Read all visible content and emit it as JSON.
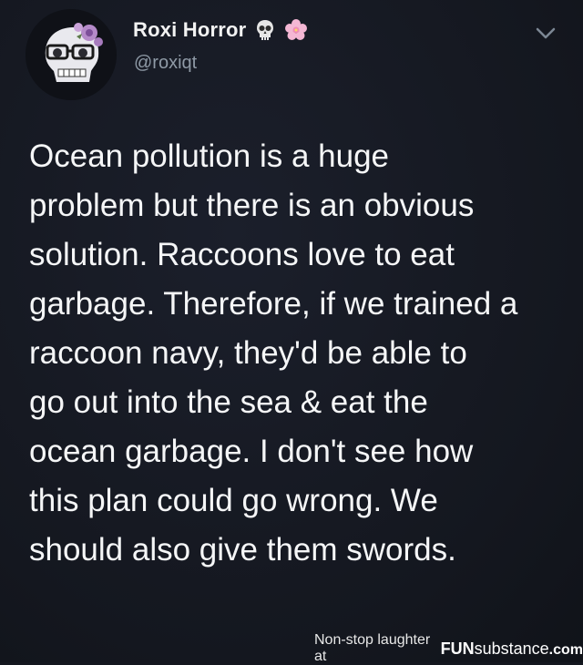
{
  "tweet": {
    "display_name": "Roxi Horror",
    "name_emojis": [
      "skull-icon",
      "cherry-blossom-icon"
    ],
    "handle": "@roxiqt",
    "text": "Ocean pollution is a huge\nproblem but there is an obvious\nsolution. Raccoons love to eat\ngarbage. Therefore, if we trained a\nraccoon navy, they'd be able to\ngo out into the sea & eat the\nocean garbage. I don't see how\nthis plan could go wrong. We\nshould also give them swords."
  },
  "footer": {
    "tagline": "Non-stop laughter at",
    "brand_main": "FUN",
    "brand_sub": "substance",
    "brand_domain": ".com"
  },
  "colors": {
    "background": "#14171f",
    "text": "#f5f6f7",
    "handle": "#8f9aa6",
    "blossom": "#f4b7d4"
  }
}
